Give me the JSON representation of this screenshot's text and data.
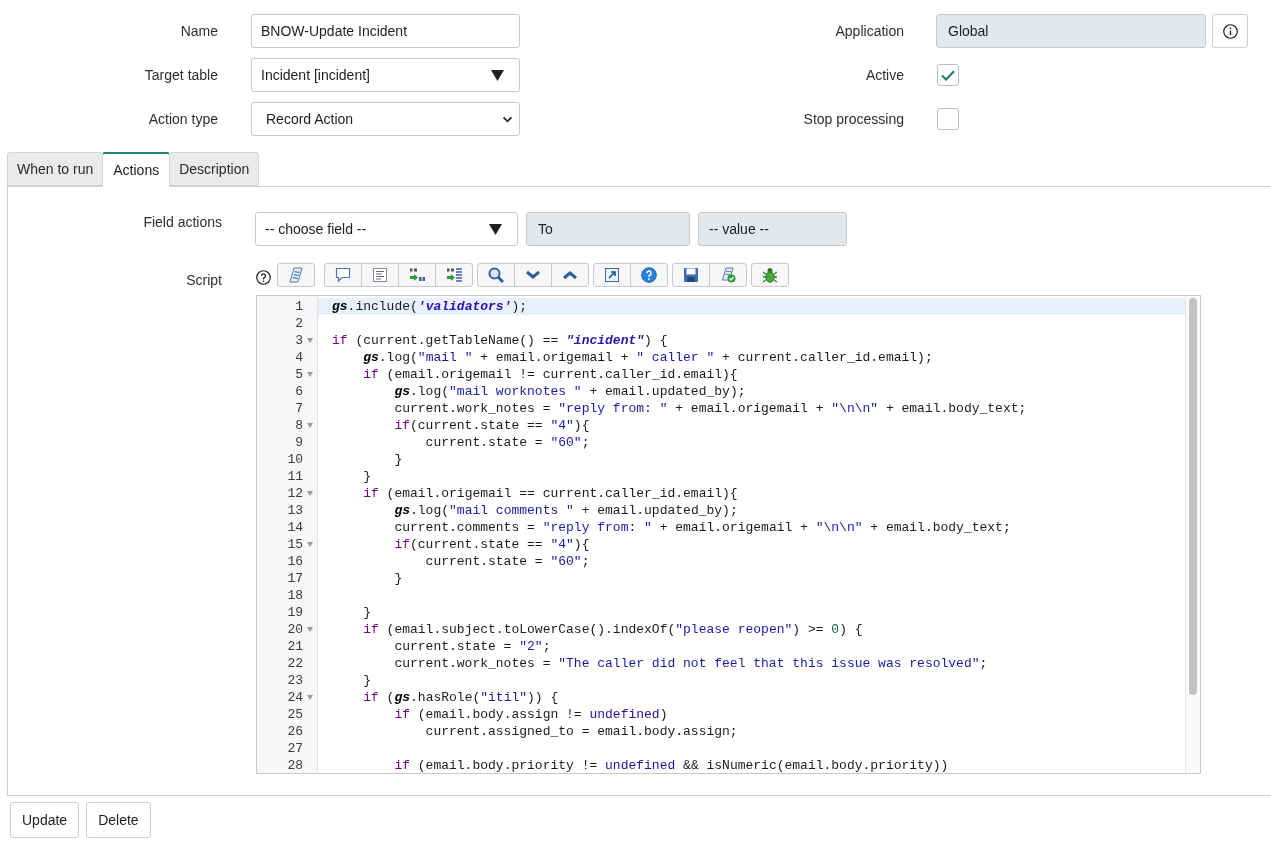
{
  "form": {
    "left_fields": [
      {
        "label": "Name",
        "kind": "text",
        "value": "BNOW-Update Incident"
      },
      {
        "label": "Target table",
        "kind": "reference",
        "value": "Incident [incident]"
      },
      {
        "label": "Action type",
        "kind": "select",
        "value": "Record Action"
      }
    ],
    "right_fields": [
      {
        "label": "Application",
        "kind": "readonly",
        "value": "Global"
      },
      {
        "label": "Active",
        "kind": "checkbox",
        "checked": true
      },
      {
        "label": "Stop processing",
        "kind": "checkbox",
        "checked": false
      }
    ]
  },
  "tabs": [
    {
      "label": "When to run",
      "selected": false
    },
    {
      "label": "Actions",
      "selected": true
    },
    {
      "label": "Description",
      "selected": false
    }
  ],
  "field_actions": {
    "label": "Field actions",
    "field": "-- choose field --",
    "operator": "To",
    "value": "-- value --"
  },
  "script": {
    "label": "Script",
    "lines": [
      {
        "number": "1",
        "fold": false,
        "active": true,
        "tokens": [
          {
            "kind": "global",
            "text": "gs"
          },
          {
            "kind": "plain",
            "text": ".include("
          },
          {
            "kind": "string-bold",
            "text": "'validators'"
          },
          {
            "kind": "plain",
            "text": ");"
          }
        ]
      },
      {
        "number": "2",
        "fold": false,
        "active": false
      },
      {
        "number": "3",
        "fold": true,
        "active": false,
        "tokens": [
          {
            "kind": "keyword",
            "text": "if"
          },
          {
            "kind": "plain",
            "text": " (current.getTableName() == "
          },
          {
            "kind": "string-bold",
            "text": "\"incident\""
          },
          {
            "kind": "plain",
            "text": ") {"
          }
        ]
      },
      {
        "number": "4",
        "fold": false,
        "active": false,
        "tokens": [
          {
            "kind": "global",
            "text": "    gs"
          },
          {
            "kind": "plain",
            "text": ".log("
          },
          {
            "kind": "string",
            "text": "\"mail \""
          },
          {
            "kind": "plain",
            "text": " + email.origemail + "
          },
          {
            "kind": "string",
            "text": "\" caller \""
          },
          {
            "kind": "plain",
            "text": " + current.caller_id.email);"
          }
        ]
      },
      {
        "number": "5",
        "fold": true,
        "active": false,
        "tokens": [
          {
            "kind": "keyword",
            "text": "    if"
          },
          {
            "kind": "plain",
            "text": " (email.origemail != current.caller_id.email){"
          }
        ]
      },
      {
        "number": "6",
        "fold": false,
        "active": false,
        "tokens": [
          {
            "kind": "global",
            "text": "        gs"
          },
          {
            "kind": "plain",
            "text": ".log("
          },
          {
            "kind": "string",
            "text": "\"mail worknotes \""
          },
          {
            "kind": "plain",
            "text": " + email.updated_by);"
          }
        ]
      },
      {
        "number": "7",
        "fold": false,
        "active": false,
        "tokens": [
          {
            "kind": "plain",
            "text": "        current.work_notes = "
          },
          {
            "kind": "string",
            "text": "\"reply from: \""
          },
          {
            "kind": "plain",
            "text": " + email.origemail + "
          },
          {
            "kind": "string",
            "text": "\"\\n\\n\""
          },
          {
            "kind": "plain",
            "text": " + email.body_text;"
          }
        ]
      },
      {
        "number": "8",
        "fold": true,
        "active": false,
        "tokens": [
          {
            "kind": "keyword",
            "text": "        if"
          },
          {
            "kind": "plain",
            "text": "(current.state == "
          },
          {
            "kind": "string",
            "text": "\"4\""
          },
          {
            "kind": "plain",
            "text": "){"
          }
        ]
      },
      {
        "number": "9",
        "fold": false,
        "active": false,
        "tokens": [
          {
            "kind": "plain",
            "text": "            current.state = "
          },
          {
            "kind": "string",
            "text": "\"60\""
          },
          {
            "kind": "plain",
            "text": ";"
          }
        ]
      },
      {
        "number": "10",
        "fold": false,
        "active": false,
        "tokens": [
          {
            "kind": "plain",
            "text": "        }"
          }
        ]
      },
      {
        "number": "11",
        "fold": false,
        "active": false,
        "tokens": [
          {
            "kind": "plain",
            "text": "    }"
          }
        ]
      },
      {
        "number": "12",
        "fold": true,
        "active": false,
        "tokens": [
          {
            "kind": "keyword",
            "text": "    if"
          },
          {
            "kind": "plain",
            "text": " (email.origemail == current.caller_id.email){"
          }
        ]
      },
      {
        "number": "13",
        "fold": false,
        "active": false,
        "tokens": [
          {
            "kind": "global",
            "text": "        gs"
          },
          {
            "kind": "plain",
            "text": ".log("
          },
          {
            "kind": "string",
            "text": "\"mail comments \""
          },
          {
            "kind": "plain",
            "text": " + email.updated_by);"
          }
        ]
      },
      {
        "number": "14",
        "fold": false,
        "active": false,
        "tokens": [
          {
            "kind": "plain",
            "text": "        current.comments = "
          },
          {
            "kind": "string",
            "text": "\"reply from: \""
          },
          {
            "kind": "plain",
            "text": " + email.origemail + "
          },
          {
            "kind": "string",
            "text": "\"\\n\\n\""
          },
          {
            "kind": "plain",
            "text": " + email.body_text;"
          }
        ]
      },
      {
        "number": "15",
        "fold": true,
        "active": false,
        "tokens": [
          {
            "kind": "keyword",
            "text": "        if"
          },
          {
            "kind": "plain",
            "text": "(current.state == "
          },
          {
            "kind": "string",
            "text": "\"4\""
          },
          {
            "kind": "plain",
            "text": "){"
          }
        ]
      },
      {
        "number": "16",
        "fold": false,
        "active": false,
        "tokens": [
          {
            "kind": "plain",
            "text": "            current.state = "
          },
          {
            "kind": "string",
            "text": "\"60\""
          },
          {
            "kind": "plain",
            "text": ";"
          }
        ]
      },
      {
        "number": "17",
        "fold": false,
        "active": false,
        "tokens": [
          {
            "kind": "plain",
            "text": "        }"
          }
        ]
      },
      {
        "number": "18",
        "fold": false,
        "active": false
      },
      {
        "number": "19",
        "fold": false,
        "active": false,
        "tokens": [
          {
            "kind": "plain",
            "text": "    }"
          }
        ]
      },
      {
        "number": "20",
        "fold": true,
        "active": false,
        "tokens": [
          {
            "kind": "keyword",
            "text": "    if"
          },
          {
            "kind": "plain",
            "text": " (email.subject.toLowerCase().indexOf("
          },
          {
            "kind": "string",
            "text": "\"please reopen\""
          },
          {
            "kind": "plain",
            "text": ") >= "
          },
          {
            "kind": "number",
            "text": "0"
          },
          {
            "kind": "plain",
            "text": ") {"
          }
        ]
      },
      {
        "number": "21",
        "fold": false,
        "active": false,
        "tokens": [
          {
            "kind": "plain",
            "text": "        current.state = "
          },
          {
            "kind": "string",
            "text": "\"2\""
          },
          {
            "kind": "plain",
            "text": ";"
          }
        ]
      },
      {
        "number": "22",
        "fold": false,
        "active": false,
        "tokens": [
          {
            "kind": "plain",
            "text": "        current.work_notes = "
          },
          {
            "kind": "string",
            "text": "\"The caller did not feel that this issue was resolved\""
          },
          {
            "kind": "plain",
            "text": ";"
          }
        ]
      },
      {
        "number": "23",
        "fold": false,
        "active": false,
        "tokens": [
          {
            "kind": "plain",
            "text": "    }"
          }
        ]
      },
      {
        "number": "24",
        "fold": true,
        "active": false,
        "tokens": [
          {
            "kind": "keyword",
            "text": "    if"
          },
          {
            "kind": "plain",
            "text": " ("
          },
          {
            "kind": "global",
            "text": "gs"
          },
          {
            "kind": "plain",
            "text": ".hasRole("
          },
          {
            "kind": "string",
            "text": "\"itil\""
          },
          {
            "kind": "plain",
            "text": ")) {"
          }
        ]
      },
      {
        "number": "25",
        "fold": false,
        "active": false,
        "tokens": [
          {
            "kind": "keyword",
            "text": "        if"
          },
          {
            "kind": "plain",
            "text": " (email.body.assign != "
          },
          {
            "kind": "atom",
            "text": "undefined"
          },
          {
            "kind": "plain",
            "text": ")"
          }
        ]
      },
      {
        "number": "26",
        "fold": false,
        "active": false,
        "tokens": [
          {
            "kind": "plain",
            "text": "            current.assigned_to = email.body.assign;"
          }
        ]
      },
      {
        "number": "27",
        "fold": false,
        "active": false
      },
      {
        "number": "28",
        "fold": false,
        "active": false,
        "tokens": [
          {
            "kind": "keyword",
            "text": "        if"
          },
          {
            "kind": "plain",
            "text": " (email.body.priority != "
          },
          {
            "kind": "atom",
            "text": "undefined"
          },
          {
            "kind": "plain",
            "text": " && isNumeric(email.body.priority))"
          }
        ]
      }
    ]
  },
  "buttons": [
    "Update",
    "Delete"
  ]
}
